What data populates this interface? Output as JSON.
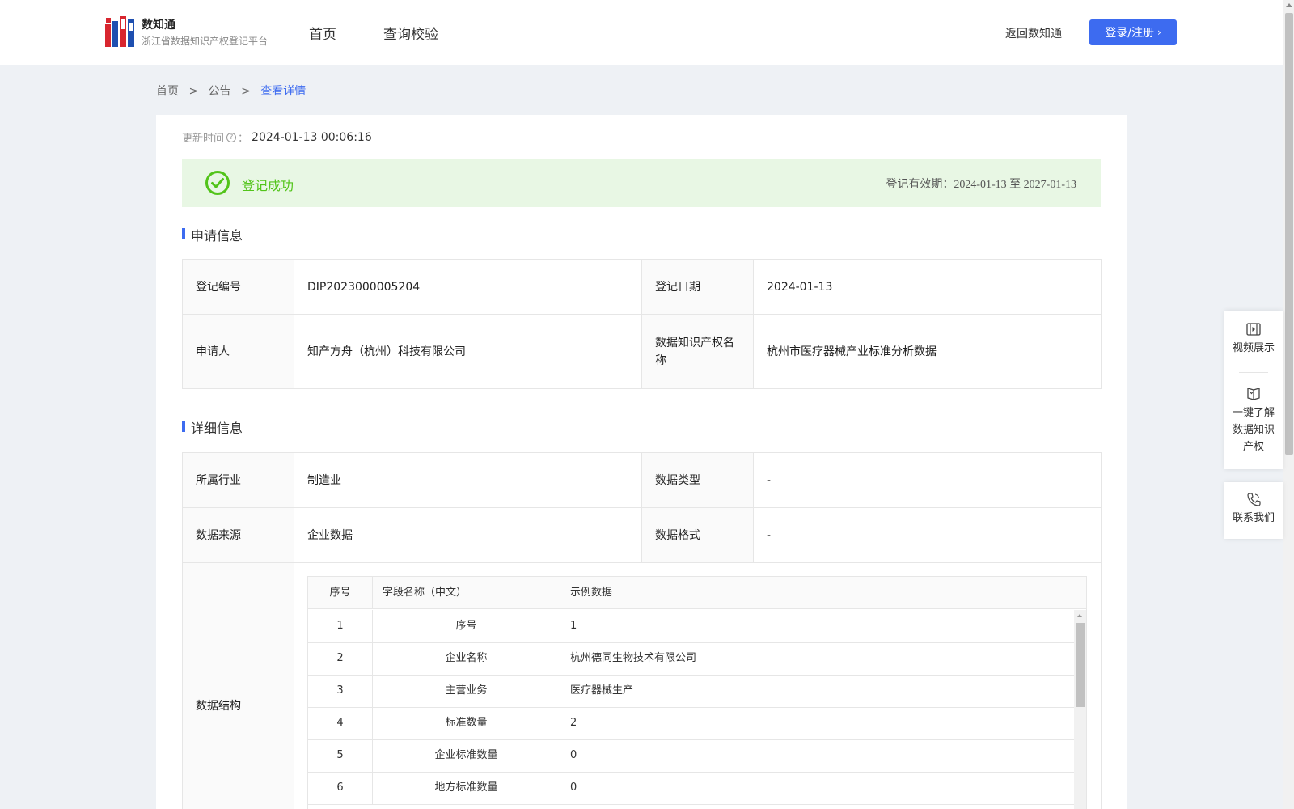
{
  "header": {
    "brand_title": "数知通",
    "brand_subtitle": "浙江省数据知识产权登记平台",
    "nav": [
      {
        "label": "首页"
      },
      {
        "label": "查询校验"
      }
    ],
    "back_link": "返回数知通",
    "login_button": "登录/注册"
  },
  "breadcrumb": {
    "items": [
      "首页",
      "公告",
      "查看详情"
    ],
    "separator": ">"
  },
  "detail": {
    "update_label": "更新时间",
    "update_colon": "：",
    "update_value": "2024-01-13 00:06:16",
    "status_text": "登记成功",
    "validity_label": "登记有效期：",
    "validity_value": "2024-01-13 至 2027-01-13",
    "status_color": "#52c41a"
  },
  "application_info": {
    "title": "申请信息",
    "rows": [
      {
        "l1": "登记编号",
        "v1": "DIP2023000005204",
        "l2": "登记日期",
        "v2": "2024-01-13"
      },
      {
        "l1": "申请人",
        "v1": "知产方舟（杭州）科技有限公司",
        "l2": "数据知识产权名称",
        "v2": "杭州市医疗器械产业标准分析数据"
      }
    ]
  },
  "detail_info": {
    "title": "详细信息",
    "rows": [
      {
        "l1": "所属行业",
        "v1": "制造业",
        "l2": "数据类型",
        "v2": "-"
      },
      {
        "l1": "数据来源",
        "v1": "企业数据",
        "l2": "数据格式",
        "v2": "-"
      }
    ],
    "structure_label": "数据结构",
    "structure_headers": {
      "idx": "序号",
      "name": "字段名称（中文）",
      "example": "示例数据"
    },
    "structure_rows": [
      {
        "idx": "1",
        "name": "序号",
        "example": "1"
      },
      {
        "idx": "2",
        "name": "企业名称",
        "example": "杭州德同生物技术有限公司"
      },
      {
        "idx": "3",
        "name": "主营业务",
        "example": "医疗器械生产"
      },
      {
        "idx": "4",
        "name": "标准数量",
        "example": "2"
      },
      {
        "idx": "5",
        "name": "企业标准数量",
        "example": "0"
      },
      {
        "idx": "6",
        "name": "地方标准数量",
        "example": "0"
      }
    ]
  },
  "side_panel": {
    "video": "视频展示",
    "learn": [
      "一键了解",
      "数据知识",
      "产权"
    ],
    "contact": "联系我们"
  },
  "colors": {
    "accent": "#3d6bf0",
    "success_bg": "#e8f7e4",
    "page_bg": "#eef1f5"
  }
}
